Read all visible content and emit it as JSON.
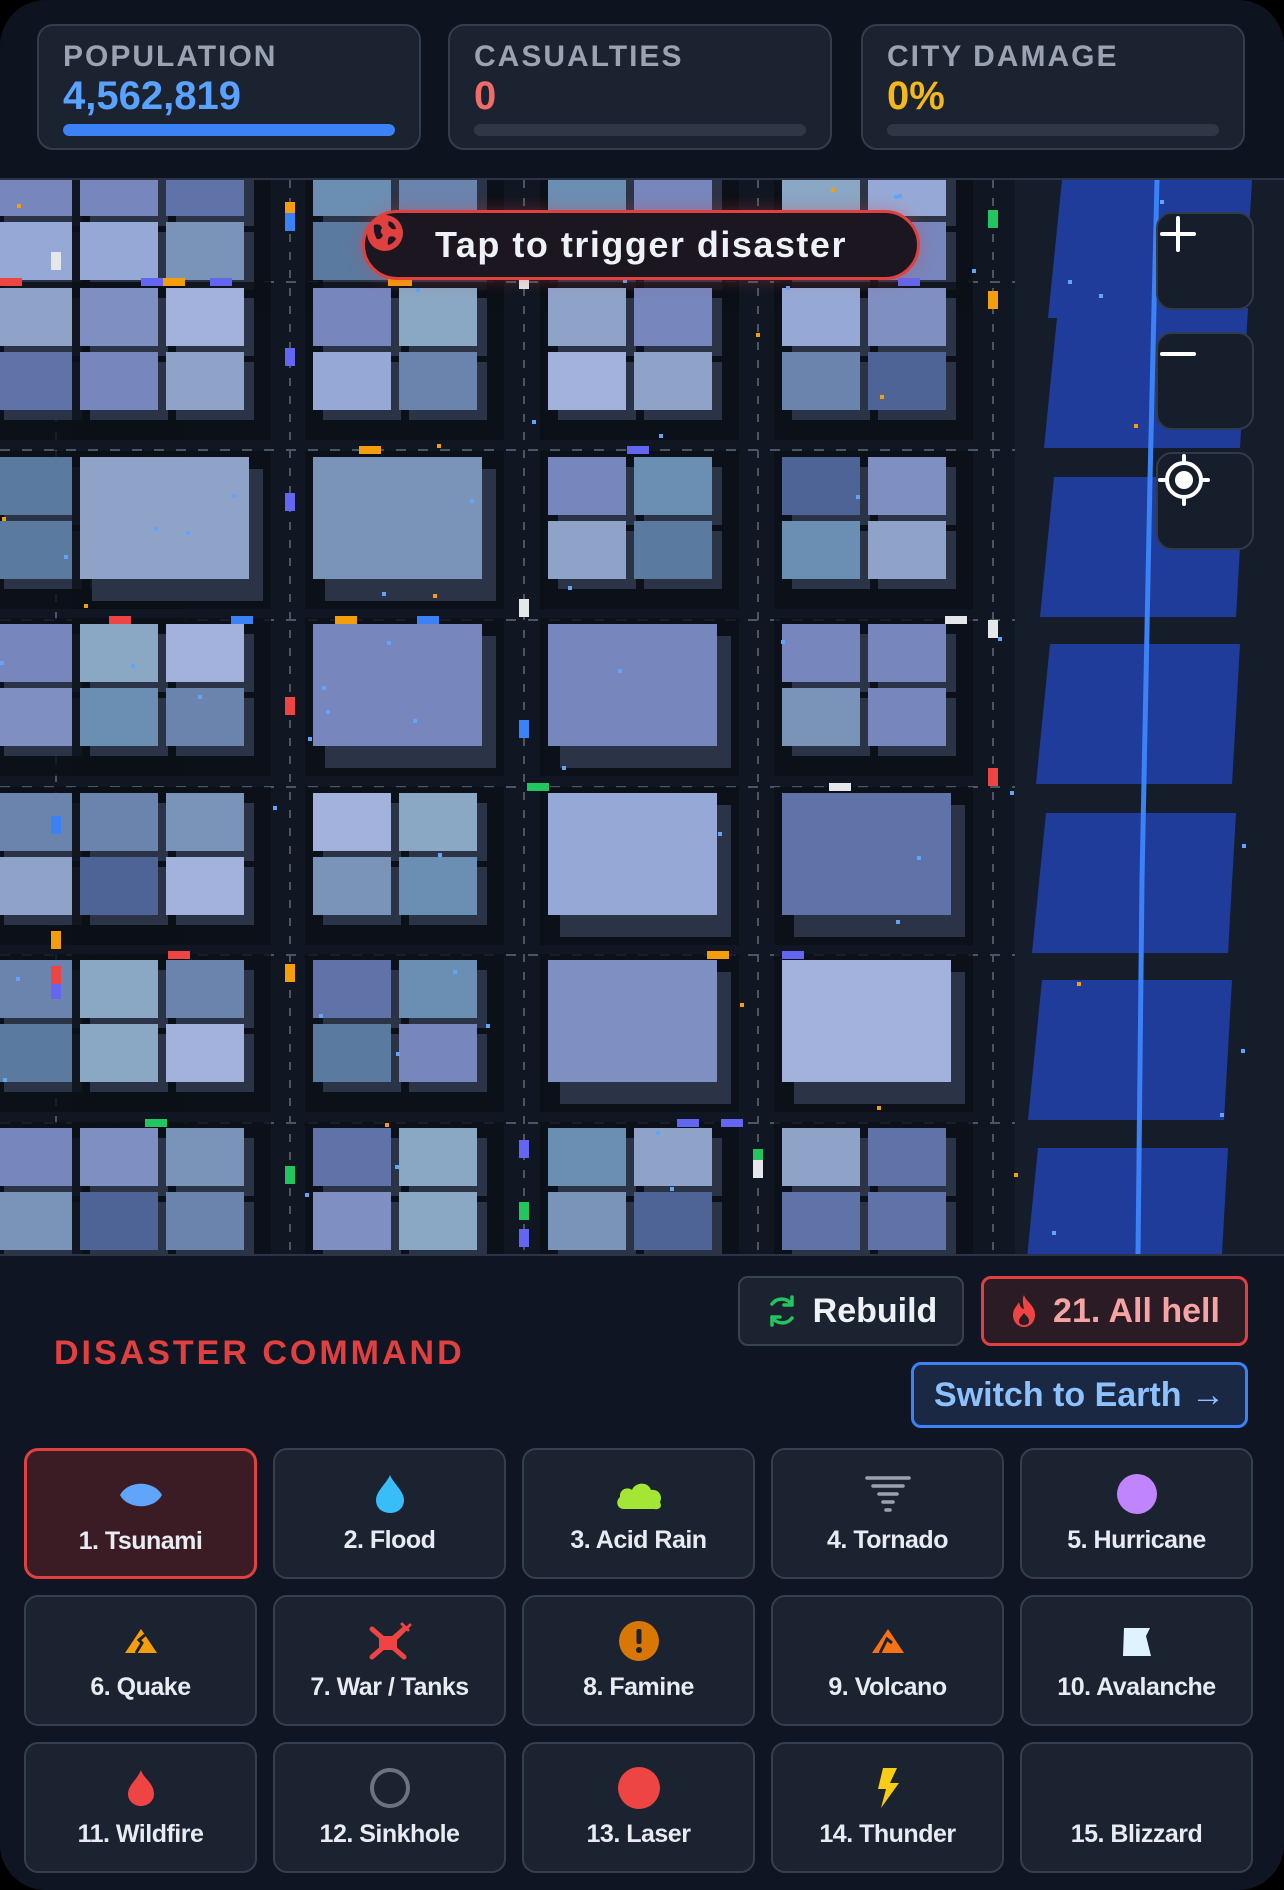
{
  "stats": {
    "population": {
      "label": "POPULATION",
      "value": "4,562,819",
      "progress": 1.0,
      "color": "#5aa2ff",
      "bar_color": "#3b82f6"
    },
    "casualties": {
      "label": "CASUALTIES",
      "value": "0",
      "progress": 0.0,
      "color": "#f26b6b",
      "bar_color": "#ef4444"
    },
    "damage": {
      "label": "CITY DAMAGE",
      "value": "0%",
      "progress": 0.0,
      "color": "#f5b81c",
      "bar_color": "#f59e0b"
    }
  },
  "map": {
    "trigger_label": "Tap to trigger disaster",
    "controls": {
      "zoom_in": "plus-icon",
      "zoom_out": "minus-icon",
      "recenter": "crosshair-icon"
    }
  },
  "panel": {
    "title": "DISASTER COMMAND",
    "rebuild_label": "Rebuild",
    "all_hell_label": "21. All hell",
    "switch_label": "Switch to Earth →",
    "selected": 0,
    "disasters": [
      {
        "label": "1. Tsunami",
        "icon": "wave-icon",
        "color": "#60a5fa"
      },
      {
        "label": "2. Flood",
        "icon": "droplet-icon",
        "color": "#38bdf8"
      },
      {
        "label": "3. Acid Rain",
        "icon": "cloud-icon",
        "color": "#a3e635"
      },
      {
        "label": "4. Tornado",
        "icon": "tornado-icon",
        "color": "#9ca3af"
      },
      {
        "label": "5. Hurricane",
        "icon": "hurricane-icon",
        "color": "#c084fc"
      },
      {
        "label": "6. Quake",
        "icon": "quake-icon",
        "color": "#f59e0b"
      },
      {
        "label": "7. War / Tanks",
        "icon": "tank-icon",
        "color": "#ef4444"
      },
      {
        "label": "8. Famine",
        "icon": "alert-icon",
        "color": "#d97706"
      },
      {
        "label": "9. Volcano",
        "icon": "volcano-icon",
        "color": "#f97316"
      },
      {
        "label": "10. Avalanche",
        "icon": "avalanche-icon",
        "color": "#e0f2fe"
      },
      {
        "label": "11. Wildfire",
        "icon": "flame-icon",
        "color": "#ef4444"
      },
      {
        "label": "12. Sinkhole",
        "icon": "ring-icon",
        "color": "#6b7280"
      },
      {
        "label": "13. Laser",
        "icon": "laser-dot-icon",
        "color": "#ef4444"
      },
      {
        "label": "14. Thunder",
        "icon": "bolt-icon",
        "color": "#facc15"
      },
      {
        "label": "15. Blizzard",
        "icon": "snow-icon",
        "color": "#e5e7eb"
      }
    ]
  }
}
